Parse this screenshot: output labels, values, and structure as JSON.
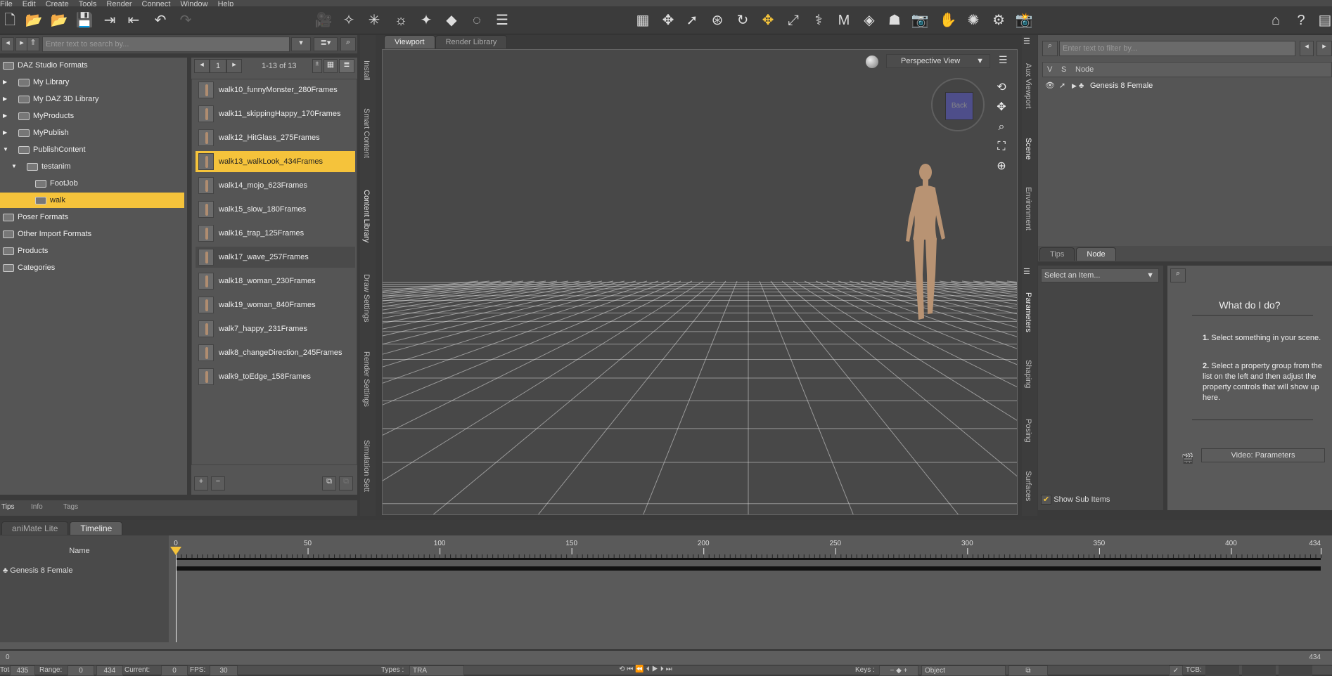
{
  "menu": [
    "File",
    "Edit",
    "Create",
    "Tools",
    "Render",
    "Connect",
    "Window",
    "Help"
  ],
  "library": {
    "search_placeholder": "Enter text to search by...",
    "tree": [
      {
        "label": "DAZ Studio Formats",
        "level": 0
      },
      {
        "label": "My Library",
        "level": 1
      },
      {
        "label": "My DAZ 3D Library",
        "level": 1
      },
      {
        "label": "MyProducts",
        "level": 1
      },
      {
        "label": "MyPublish",
        "level": 1
      },
      {
        "label": "PublishContent",
        "level": 1
      },
      {
        "label": "testanim",
        "level": 2
      },
      {
        "label": "FootJob",
        "level": 3
      },
      {
        "label": "walk",
        "level": 3,
        "selected": true
      },
      {
        "label": "Poser Formats",
        "level": 0
      },
      {
        "label": "Other Import Formats",
        "level": 0
      },
      {
        "label": "Products",
        "level": 0
      },
      {
        "label": "Categories",
        "level": 0
      }
    ],
    "page": "1",
    "count": "1-13 of 13",
    "files": [
      "walk10_funnyMonster_280Frames",
      "walk11_skippingHappy_170Frames",
      "walk12_HitGlass_275Frames",
      "walk13_walkLook_434Frames",
      "walk14_mojo_623Frames",
      "walk15_slow_180Frames",
      "walk16_trap_125Frames",
      "walk17_wave_257Frames",
      "walk18_woman_230Frames",
      "walk19_woman_840Frames",
      "walk7_happy_231Frames",
      "walk8_changeDirection_245Frames",
      "walk9_toEdge_158Frames"
    ],
    "selected_file": 3,
    "bottom_tabs": [
      "Tips",
      "Info",
      "Tags"
    ],
    "side_tabs": [
      "Install",
      "Smart Content",
      "Content Library",
      "Draw Settings",
      "Render Settings",
      "Simulation Sett"
    ]
  },
  "viewport": {
    "tabs": [
      "Viewport",
      "Render Library"
    ],
    "view": "Perspective View",
    "cube_label": "Back"
  },
  "scene": {
    "side_tabs": [
      "Aux Viewport",
      "Scene",
      "Environment"
    ],
    "filter_placeholder": "Enter text to filter by...",
    "cols": [
      "V",
      "S",
      "Node"
    ],
    "node": "Genesis 8 Female",
    "bottom_tabs": [
      "Tips",
      "Node"
    ]
  },
  "params": {
    "side_tabs": [
      "Parameters",
      "Shaping",
      "Posing",
      "Surfaces"
    ],
    "select": "Select an Item...",
    "title": "What do I do?",
    "step1_num": "1.",
    "step1": "Select something in your scene.",
    "step2_num": "2.",
    "step2": "Select a property group from the list on the left and then adjust the property controls that will show up here.",
    "video": "Video: Parameters",
    "show_sub": "Show Sub Items"
  },
  "timeline": {
    "tabs": [
      "aniMate Lite",
      "Timeline"
    ],
    "name_header": "Name",
    "track": "Genesis 8 Female",
    "ticks": [
      "0",
      "50",
      "100",
      "150",
      "200",
      "250",
      "300",
      "350",
      "400",
      "434"
    ],
    "start": "0",
    "end": "434"
  },
  "bottom": {
    "total_label": "Total:",
    "total": "435",
    "range_label": "Range:",
    "range_start": "0",
    "range_end": "434",
    "current_label": "Current:",
    "current": "0",
    "fps_label": "FPS:",
    "fps": "30",
    "types_label": "Types :",
    "types": "TRA",
    "keys_label": "Keys :",
    "keys": "Object",
    "tcb_label": "TCB:"
  }
}
